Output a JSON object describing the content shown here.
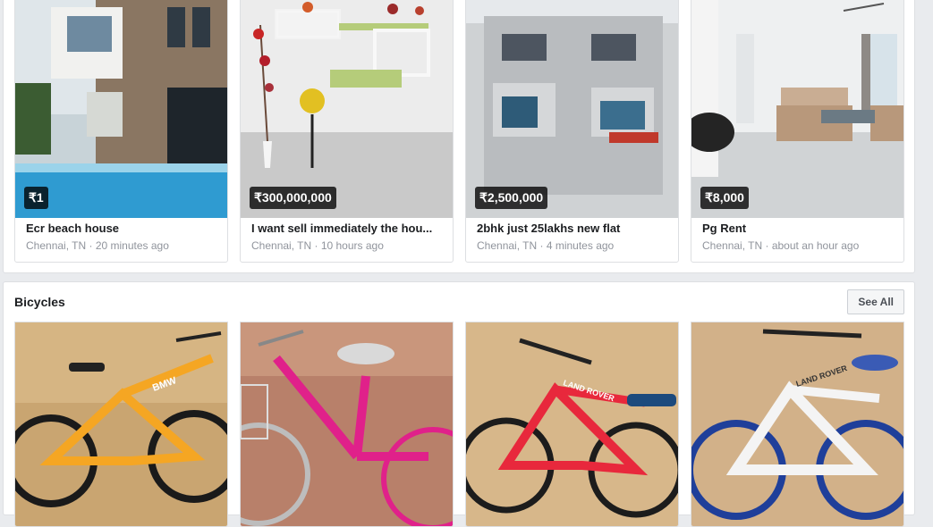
{
  "property": {
    "listings": [
      {
        "price": "₹1",
        "title": "Ecr beach house",
        "location": "Chennai, TN",
        "time": "20 minutes ago"
      },
      {
        "price": "₹300,000,000",
        "title": "I want sell immediately the hou...",
        "location": "Chennai, TN",
        "time": "10 hours ago"
      },
      {
        "price": "₹2,500,000",
        "title": "2bhk just 25lakhs new flat",
        "location": "Chennai, TN",
        "time": "4 minutes ago"
      },
      {
        "price": "₹8,000",
        "title": "Pg Rent",
        "location": "Chennai, TN",
        "time": "about an hour ago"
      }
    ]
  },
  "bicycles": {
    "title": "Bicycles",
    "see_all_label": "See All",
    "listings": [
      {
        "brand_text": "BMW",
        "color": "#f5a623"
      },
      {
        "brand_text": "",
        "color": "#e0218a"
      },
      {
        "brand_text": "LAND ROVER",
        "color": "#e8283c"
      },
      {
        "brand_text": "LAND ROVER",
        "color": "#f4f4f4"
      }
    ]
  },
  "colors": {
    "page_bg": "#e9ebee",
    "card_border": "#dddfe2",
    "title_text": "#1c1e21",
    "meta_text": "#90949c"
  }
}
